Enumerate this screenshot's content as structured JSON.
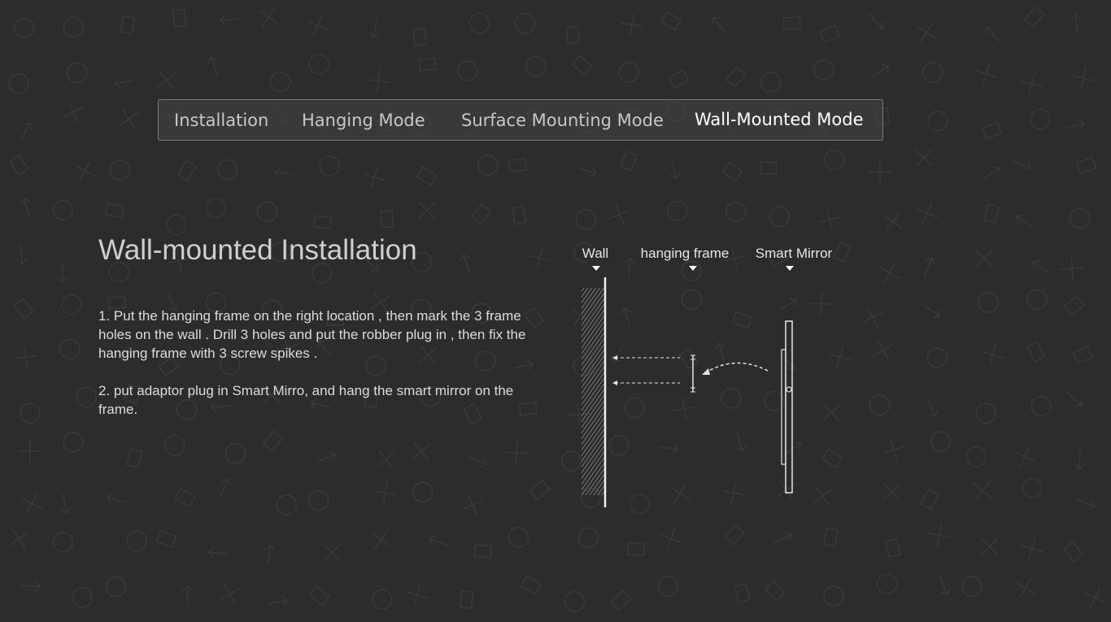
{
  "tabs": [
    {
      "label": "Installation",
      "active": false
    },
    {
      "label": "Hanging Mode",
      "active": false
    },
    {
      "label": "Surface Mounting Mode",
      "active": false
    },
    {
      "label": "Wall-Mounted Mode",
      "active": true
    }
  ],
  "main": {
    "title": "Wall-mounted Installation",
    "steps": [
      "1. Put the hanging frame on the right location , then mark the 3 frame holes on the wall . Drill 3 holes and put the robber plug in  , then fix the hanging frame with 3 screw spikes .",
      "2. put adaptor plug in Smart Mirro, and hang the smart mirror on the frame."
    ]
  },
  "diagram": {
    "labels": {
      "wall": "Wall",
      "frame": "hanging frame",
      "mirror": "Smart Mirror"
    }
  },
  "colors": {
    "background": "#2c2c2c",
    "text": "#dcdcdc",
    "active_tab": "#ffffff",
    "inactive_tab": "#c7c7c7"
  }
}
